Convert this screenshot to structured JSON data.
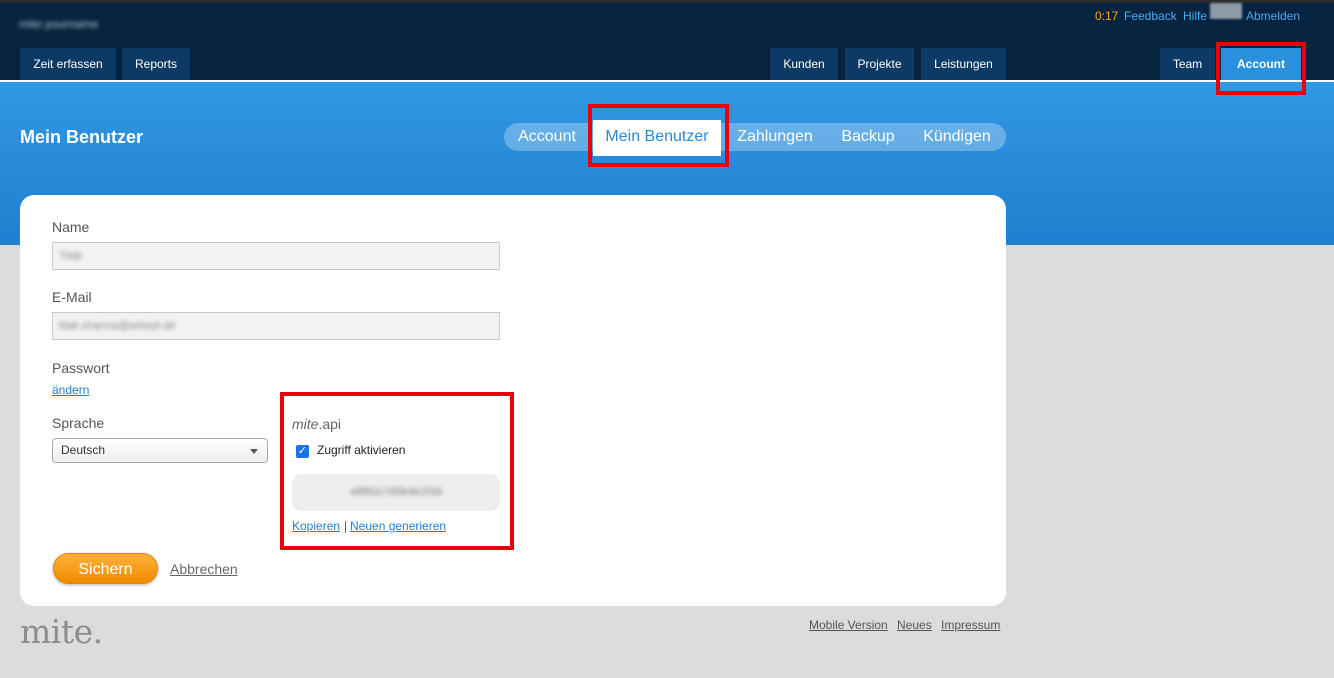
{
  "header": {
    "org_name": "mite.yourname",
    "timer": "0:17",
    "links": {
      "feedback": "Feedback",
      "help": "Hilfe",
      "logout": "Abmelden"
    },
    "nav_left": [
      "Zeit erfassen",
      "Reports"
    ],
    "nav_center": [
      "Kunden",
      "Projekte",
      "Leistungen"
    ],
    "nav_right": [
      "Team",
      "Account"
    ]
  },
  "page": {
    "title": "Mein Benutzer",
    "subtabs": [
      "Account",
      "Mein Benutzer",
      "Zahlungen",
      "Backup",
      "Kündigen"
    ],
    "active_subtab": "Mein Benutzer"
  },
  "form": {
    "name_label": "Name",
    "name_value": "Tilak",
    "email_label": "E-Mail",
    "email_value": "tilak.sharma@arbeyt.de",
    "password_label": "Passwort",
    "password_change_link": "ändern",
    "language_label": "Sprache",
    "language_value": "Deutsch",
    "api": {
      "title_italic": "mite",
      "title_rest": ".api",
      "checkbox_label": "Zugriff aktivieren",
      "checked": true,
      "token": "a9f82c7d5b4e1f3d",
      "copy_link": "Kopieren",
      "separator": "|",
      "regenerate_link": "Neuen generieren"
    },
    "save_label": "Sichern",
    "cancel_label": "Abbrechen"
  },
  "footer": {
    "logo": "mite.",
    "links": [
      "Mobile Version",
      "Neues",
      "Impressum"
    ]
  },
  "colors": {
    "header_bg": "#062440",
    "accent_blue": "#2990dd",
    "save_orange": "#f08a00",
    "highlight_red": "#e8000b"
  }
}
